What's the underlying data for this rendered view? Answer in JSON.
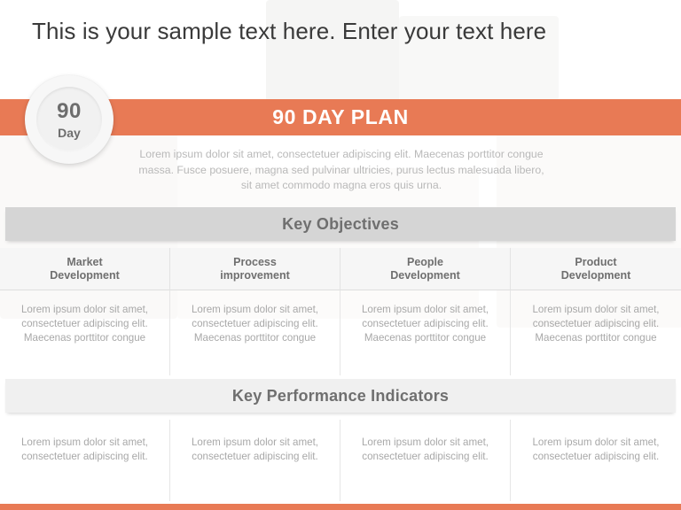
{
  "slide": {
    "sample_title": "This is your sample text here. Enter your text here",
    "accent_color": "#e87a55",
    "heading_gray": "#6f6f6f",
    "body_gray": "#a8a8a8"
  },
  "badge": {
    "number": "90",
    "unit": "Day"
  },
  "banner": {
    "title": "90 DAY PLAN"
  },
  "intro": {
    "paragraph": "Lorem ipsum dolor sit amet, consectetuer adipiscing elit. Maecenas porttitor congue massa. Fusce posuere, magna sed pulvinar ultricies, purus lectus malesuada libero, sit amet commodo magna eros quis urna."
  },
  "sections": [
    {
      "id": "key-objectives",
      "title": "Key Objectives",
      "bar_color": "#d5d5d5",
      "columns": [
        {
          "header": "Market\nDevelopment",
          "header_line1": "Market",
          "header_line2": "Development",
          "body": "Lorem ipsum dolor sit amet, consectetuer adipiscing elit. Maecenas porttitor congue"
        },
        {
          "header": "Process\nimprovement",
          "header_line1": "Process",
          "header_line2": "improvement",
          "body": "Lorem ipsum dolor sit amet, consectetuer adipiscing elit. Maecenas porttitor congue"
        },
        {
          "header": "People\nDevelopment",
          "header_line1": "People",
          "header_line2": "Development",
          "body": "Lorem ipsum dolor sit amet, consectetuer adipiscing elit. Maecenas porttitor congue"
        },
        {
          "header": "Product\nDevelopment",
          "header_line1": "Product",
          "header_line2": "Development",
          "body": "Lorem ipsum dolor sit amet, consectetuer adipiscing elit. Maecenas porttitor congue"
        }
      ]
    },
    {
      "id": "key-performance-indicators",
      "title": "Key Performance Indicators",
      "bar_color": "#f0f0f0",
      "columns": [
        {
          "body": "Lorem ipsum dolor sit amet, consectetuer adipiscing elit."
        },
        {
          "body": "Lorem ipsum dolor sit amet, consectetuer adipiscing elit."
        },
        {
          "body": "Lorem ipsum dolor sit amet, consectetuer adipiscing elit."
        },
        {
          "body": "Lorem ipsum dolor sit amet, consectetuer adipiscing elit."
        }
      ]
    }
  ]
}
